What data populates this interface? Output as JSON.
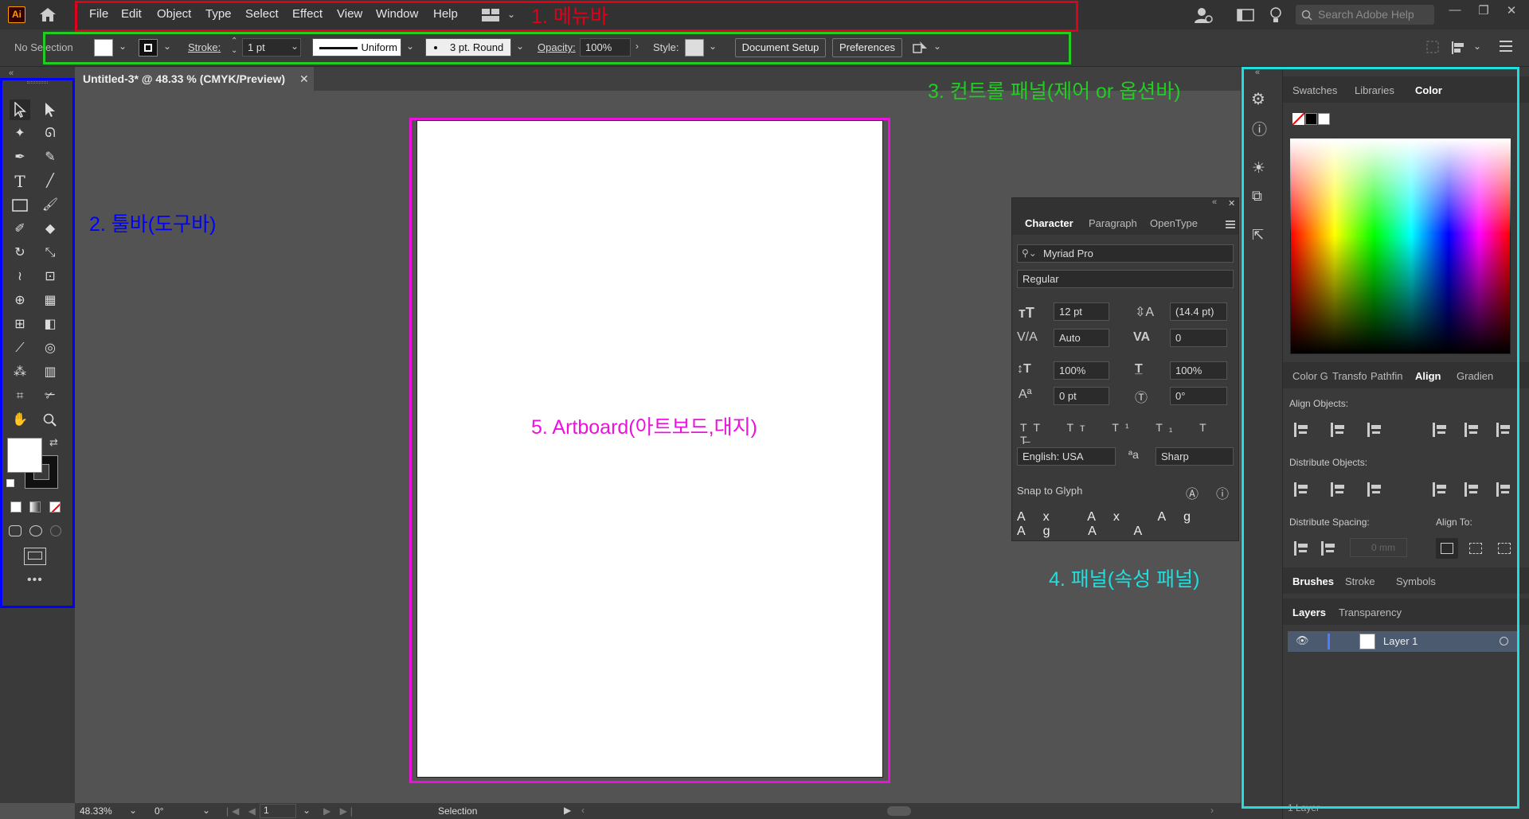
{
  "app": {
    "logo": "Ai"
  },
  "menubar": {
    "items": [
      "File",
      "Edit",
      "Object",
      "Type",
      "Select",
      "Effect",
      "View",
      "Window",
      "Help"
    ],
    "search_placeholder": "Search Adobe Help"
  },
  "control_bar": {
    "selection_label": "No Selection",
    "stroke_label": "Stroke:",
    "stroke_value": "1 pt",
    "profile_value": "Uniform",
    "brush_value": "3 pt. Round",
    "opacity_label": "Opacity:",
    "opacity_value": "100%",
    "style_label": "Style:",
    "document_setup": "Document Setup",
    "preferences": "Preferences"
  },
  "document": {
    "tab_title": "Untitled-3* @ 48.33 % (CMYK/Preview)"
  },
  "status_bar": {
    "zoom": "48.33%",
    "rotation": "0°",
    "artboard_num": "1",
    "tool": "Selection"
  },
  "right_dock": {
    "color_tabs": [
      "Swatches",
      "Libraries",
      "Color"
    ],
    "align_tabs": [
      "Color G",
      "Transfo",
      "Pathfin",
      "Align",
      "Gradien"
    ],
    "align_objects": "Align Objects:",
    "distribute_objects": "Distribute Objects:",
    "distribute_spacing": "Distribute Spacing:",
    "align_to": "Align To:",
    "spacing_value": "0 mm",
    "brush_tabs": [
      "Brushes",
      "Stroke",
      "Symbols"
    ],
    "layer_tabs": [
      "Layers",
      "Transparency"
    ],
    "layer_name": "Layer 1",
    "layer_count": "1 Layer"
  },
  "character_panel": {
    "tabs": [
      "Character",
      "Paragraph",
      "OpenType"
    ],
    "font": "Myriad Pro",
    "style": "Regular",
    "size": "12 pt",
    "leading": "(14.4 pt)",
    "kerning": "Auto",
    "tracking": "0",
    "vscale": "100%",
    "hscale": "100%",
    "baseline": "0 pt",
    "rotation": "0°",
    "language": "English: USA",
    "antialias": "Sharp",
    "snap_to_glyph": "Snap to Glyph"
  },
  "annotations": {
    "menubar": "1. 메뉴바",
    "toolbar": "2. 툴바(도구바)",
    "control": "3. 컨트롤 패널(제어 or 옵션바)",
    "panel": "4. 패널(속성 패널)",
    "artboard": "5. Artboard(아트보드,대지)"
  },
  "colors": {
    "menubar_box": "#e0001a",
    "toolbar_box": "#0000ff",
    "control_box": "#22cc22",
    "panel_box": "#22dddd",
    "artboard_box": "#ee11dd"
  }
}
